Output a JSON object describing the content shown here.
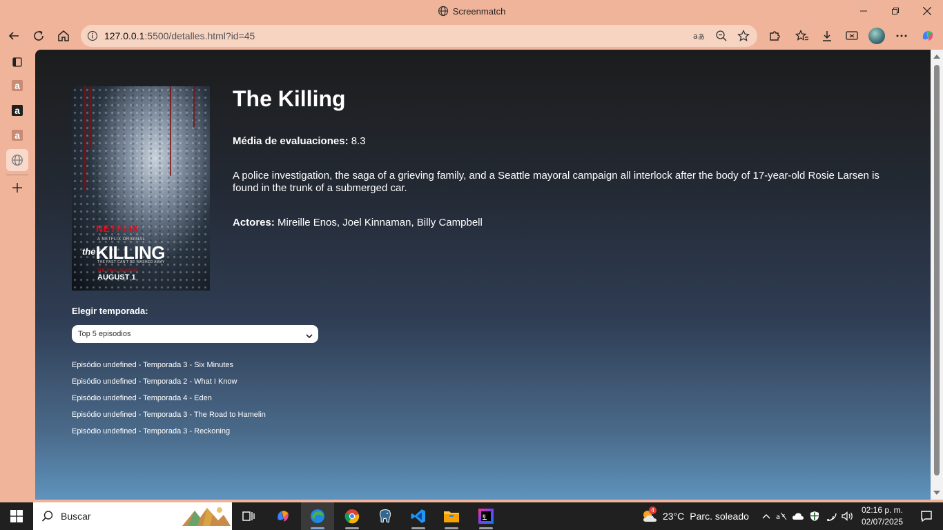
{
  "window": {
    "title": "Screenmatch"
  },
  "address_bar": {
    "url_host": "127.0.0.1",
    "url_rest": ":5500/detalles.html?id=45"
  },
  "show": {
    "title": "The Killing",
    "rating_label": "Média de evaluaciones:",
    "rating_value": "8.3",
    "synopsis": "A police investigation, the saga of a grieving family, and a Seattle mayoral campaign all interlock after the body of 17-year-old Rosie Larsen is found in the trunk of a submerged car.",
    "actors_label": "Actores:",
    "actors_value": "Mireille Enos, Joel Kinnaman, Billy Campbell"
  },
  "poster": {
    "brand": "NETFLIX",
    "subtitle": "A NETFLIX ORIGINAL",
    "logo_the": "the",
    "logo_title": "KILLING",
    "tagline": "THE PAST CAN'T BE WASHED AWAY",
    "season_note": "THE FINAL SEASON",
    "date": "AUGUST 1"
  },
  "season_selector": {
    "label": "Elegir temporada:",
    "selected": "Top 5 episodios"
  },
  "episodes": [
    "Episódio undefined - Temporada 3 - Six Minutes",
    "Episódio undefined - Temporada 2 - What I Know",
    "Episódio undefined - Temporada 4 - Eden",
    "Episódio undefined - Temporada 3 - The Road to Hamelin",
    "Episódio undefined - Temporada 3 - Reckoning"
  ],
  "taskbar": {
    "search_placeholder": "Buscar",
    "weather_badge": "4",
    "weather_temp": "23°C",
    "weather_desc": "Parc. soleado",
    "time": "02:16 p. m.",
    "date": "02/07/2025"
  },
  "colors": {
    "chrome_bg": "#f0b49a",
    "omnibox_bg": "#f7d3c2",
    "taskbar_bg": "#202020",
    "brand_red": "#e50914"
  }
}
